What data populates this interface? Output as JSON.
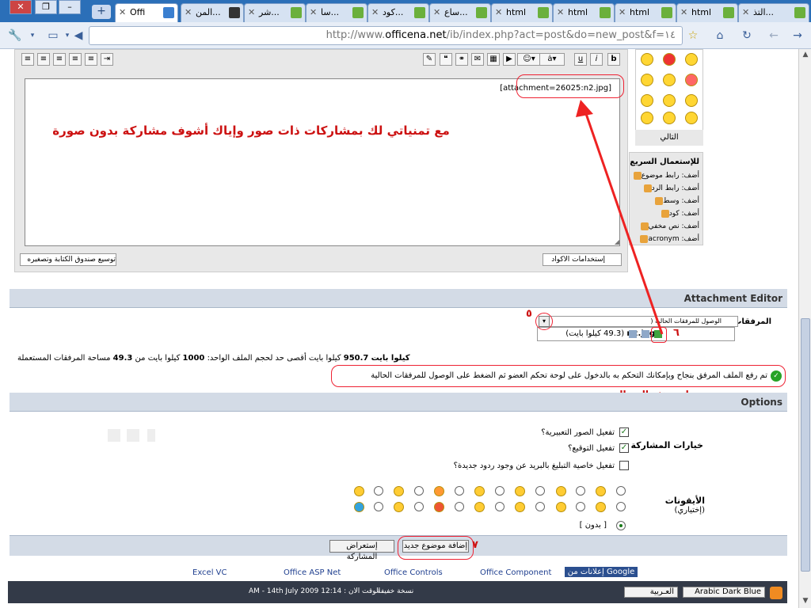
{
  "browser": {
    "tabs": [
      {
        "label": "Offi"
      },
      {
        "label": "المن..."
      },
      {
        "label": "شر..."
      },
      {
        "label": "سا..."
      },
      {
        "label": "كود..."
      },
      {
        "label": "ساع..."
      },
      {
        "label": "html"
      },
      {
        "label": "html"
      },
      {
        "label": "html"
      },
      {
        "label": "html"
      },
      {
        "label": "التذ..."
      }
    ],
    "url_prefix": "http://www.",
    "url_domain": "officena.net",
    "url_path": "/ib/index.php?act=post&do=new_post&f=١٤"
  },
  "editor": {
    "attachment_tag": "[attachment=26025:n2.jpg]",
    "red_note": "مع تمنياتي لك بمشاركات ذات صور وإياك أشوف مشاركة بدون صورة",
    "expand_label": "توسيع صندوق الكتابة وتصغيره",
    "codes_label": "إستخدامات الاكواد"
  },
  "emoticons_panel": {
    "next_label": "التالي"
  },
  "quick_panel": {
    "title": "للإستعمال السريع",
    "items": [
      "أضف: رابط موضوع",
      "أضف: رابط الرد",
      "أضف: وسط",
      "أضف: كود",
      "أضف: نص مخفي",
      "أضف: acronym"
    ]
  },
  "attachment_editor": {
    "title": "Attachment Editor",
    "label": "المرفقات",
    "select_text": "الوصول للمرفقات الحالية (",
    "item_name": "n2.jpg",
    "item_size": "(49.3 كيلوا بايت)",
    "space_text_a": "مساحة المرفقات المستعملة",
    "space_used": "49.3",
    "space_text_b": "كيلوا بايت من",
    "space_total": "1000",
    "space_text_c": "كيلوا بايت أقصى حد لحجم الملف الواحد:",
    "space_max": "950.7",
    "space_text_d": "كيلوا بايت",
    "success_msg": "تم رفع الملف المرفق بنجاح وبإمكانك التحكم به بالدخول على لوحة تحكم العضو ثم الضغط على الوصول للمرفقات الحالية",
    "appears_msg": "تظهر هذه الرسالة",
    "num5": "٥",
    "num6": "٦"
  },
  "options": {
    "title": "Options",
    "post_options_label": "خيارات المشاركة",
    "opt1": "تفعيل الصور التعبيرية؟",
    "opt2": "تفعيل التوقيع؟",
    "opt3": "تفعيل خاصية التبليغ بالبريد عن وجود ردود جديدة؟",
    "icons_label": "الأيقونات",
    "icons_optional": "(إختياري)",
    "none_label": "[ بدون ]"
  },
  "submit": {
    "add_topic": "إضافة موضوع جديد",
    "preview": "إستعراض المشاركة",
    "num7": "٧"
  },
  "footer": {
    "links": [
      "Excel VC",
      "Office ASP Net",
      "Office Controls",
      "Office Component"
    ],
    "ads": "إعلانات من Google",
    "version": "نسخة خفيفة",
    "time": "الوقت الان : 12:14 AM - 14th July 2009",
    "lang": "العـربية",
    "skin": "Arabic Dark Blue"
  },
  "colors": {
    "accent_red": "#e22222",
    "bar_blue": "#d3dbe6",
    "dark_bar": "#333a48"
  }
}
